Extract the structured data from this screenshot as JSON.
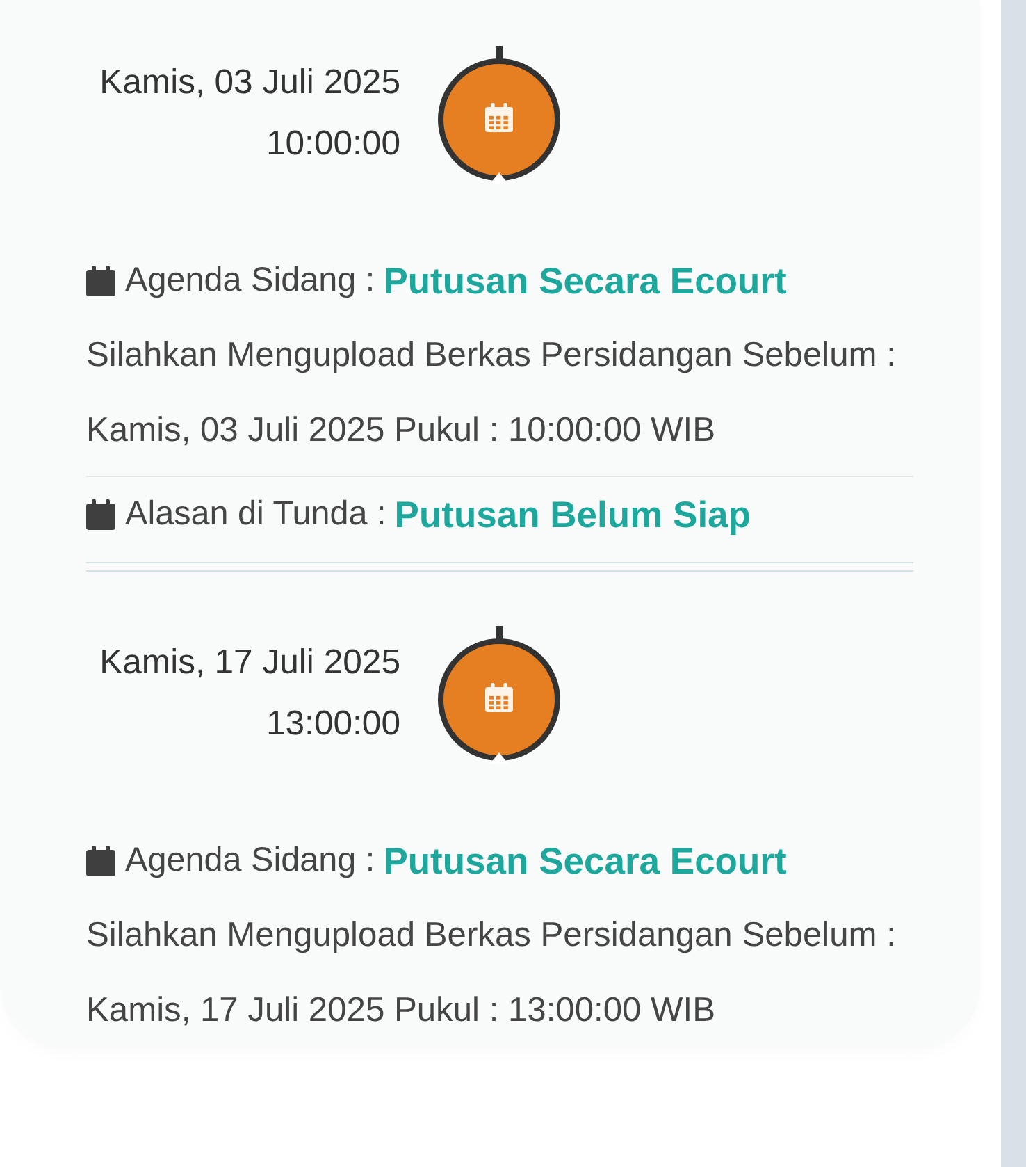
{
  "hearings": [
    {
      "date": "Kamis, 03 Juli 2025",
      "time": "10:00:00",
      "details": [
        {
          "kind": "agenda",
          "label": "Agenda Sidang :",
          "value": "Putusan Secara Ecourt"
        },
        {
          "kind": "note",
          "text": "Silahkan Mengupload Berkas Persidangan Sebelum :"
        },
        {
          "kind": "note",
          "text": "Kamis, 03 Juli 2025 Pukul : 10:00:00 WIB"
        },
        {
          "kind": "postponed",
          "label": "Alasan di Tunda :",
          "value": "Putusan Belum Siap"
        }
      ]
    },
    {
      "date": "Kamis, 17 Juli 2025",
      "time": "13:00:00",
      "details": [
        {
          "kind": "agenda",
          "label": "Agenda Sidang :",
          "value": "Putusan Secara Ecourt"
        },
        {
          "kind": "note",
          "text": "Silahkan Mengupload Berkas Persidangan Sebelum :"
        },
        {
          "kind": "note",
          "text": "Kamis, 17 Juli 2025 Pukul : 13:00:00 WIB"
        }
      ]
    }
  ]
}
